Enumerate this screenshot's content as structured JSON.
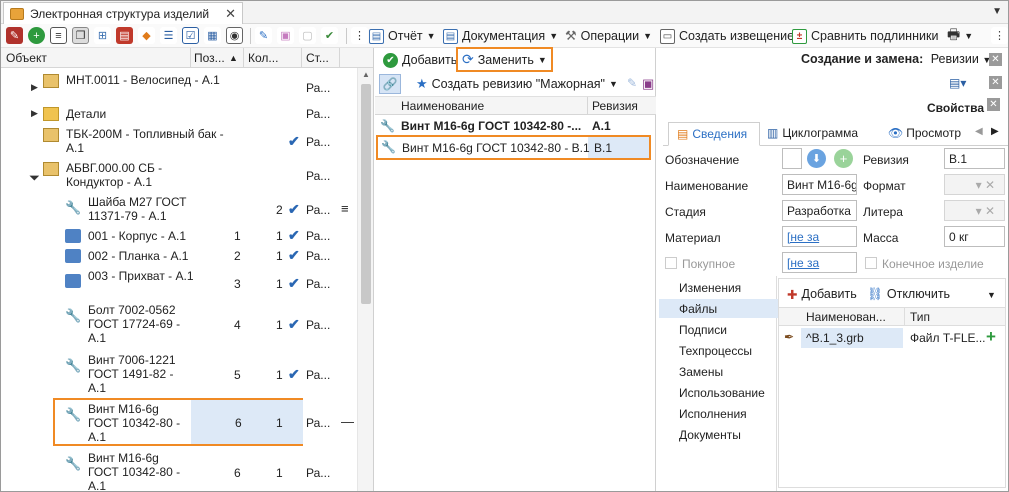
{
  "window": {
    "tab_title": "Электронная структура изделий"
  },
  "toolbar": {
    "report": "Отчёт",
    "documentation": "Документация",
    "operations": "Операции",
    "create_notice": "Создать извещение",
    "compare_originals": "Сравнить подлинники"
  },
  "tree": {
    "headers": {
      "object": "Объект",
      "pos": "Поз...",
      "count": "Кол...",
      "status": "Ст..."
    },
    "rows": [
      {
        "name": "МНТ.0011 - Велосипед - А.1",
        "pos": "",
        "count": "",
        "status": "Ра..."
      },
      {
        "name": "Детали",
        "pos": "",
        "count": "",
        "status": "Ра..."
      },
      {
        "name": "ТБК-200М - Топливный бак - А.1",
        "pos": "",
        "count": "",
        "status": "Ра..."
      },
      {
        "name": "АБВГ.000.00 СБ - Кондуктор - А.1",
        "pos": "",
        "count": "",
        "status": "Ра..."
      },
      {
        "name": "Шайба М27 ГОСТ 11371-79 - А.1",
        "pos": "",
        "count": "2",
        "status": "Ра..."
      },
      {
        "name": "001 - Корпус - А.1",
        "pos": "1",
        "count": "1",
        "status": "Ра..."
      },
      {
        "name": "002 - Планка - А.1",
        "pos": "2",
        "count": "1",
        "status": "Ра..."
      },
      {
        "name": "003 - Прихват - А.1",
        "pos": "3",
        "count": "1",
        "status": "Ра..."
      },
      {
        "name": "Болт 7002-0562 ГОСТ 17724-69 - А.1",
        "pos": "4",
        "count": "1",
        "status": "Ра..."
      },
      {
        "name": "Винт 7006-1221 ГОСТ 1491-82 - А.1",
        "pos": "5",
        "count": "1",
        "status": "Ра..."
      },
      {
        "name": "Винт М16-6g ГОСТ 10342-80 - А.1",
        "pos": "6",
        "count": "1",
        "status": "Ра..."
      },
      {
        "name": "Винт М16-6g ГОСТ 10342-80 - А.1",
        "pos": "6",
        "count": "1",
        "status": "Ра..."
      }
    ]
  },
  "middle": {
    "add": "Добавить",
    "replace": "Заменить",
    "create_revision": "Создать ревизию \"Мажорная\"",
    "col_name": "Наименование",
    "col_revision": "Ревизия",
    "rows": [
      {
        "name": "Винт М16-6g ГОСТ 10342-80 -...",
        "revision": "А.1"
      },
      {
        "name": "Винт М16-6g ГОСТ 10342-80 - В.1",
        "revision": "В.1"
      }
    ]
  },
  "right": {
    "mode_label": "Создание и замена:",
    "mode_value": "Ревизии",
    "props_title": "Свойства",
    "tabs": [
      "Сведения",
      "Циклограмма",
      "Просмотр"
    ],
    "fields": {
      "designation": "Обозначение",
      "revision": "Ревизия",
      "revision_value": "В.1",
      "name": "Наименование",
      "name_value": "Винт М16-6g",
      "format": "Формат",
      "stage": "Стадия",
      "stage_value": "Разработка",
      "litera": "Литера",
      "material": "Материал",
      "material_value": "[не за",
      "mass": "Масса",
      "mass_value": "0 кг",
      "purchased": "Покупное",
      "purchased_value": "[не за",
      "final_product": "Конечное изделие"
    },
    "nav": [
      "Изменения",
      "Файлы",
      "Подписи",
      "Техпроцессы",
      "Замены",
      "Использование",
      "Исполнения",
      "Документы"
    ],
    "files": {
      "add": "Добавить",
      "detach": "Отключить",
      "col_name": "Наименован...",
      "col_type": "Тип",
      "rows": [
        {
          "name": "^В.1_3.grb",
          "type": "Файл T-FLE..."
        }
      ]
    }
  }
}
